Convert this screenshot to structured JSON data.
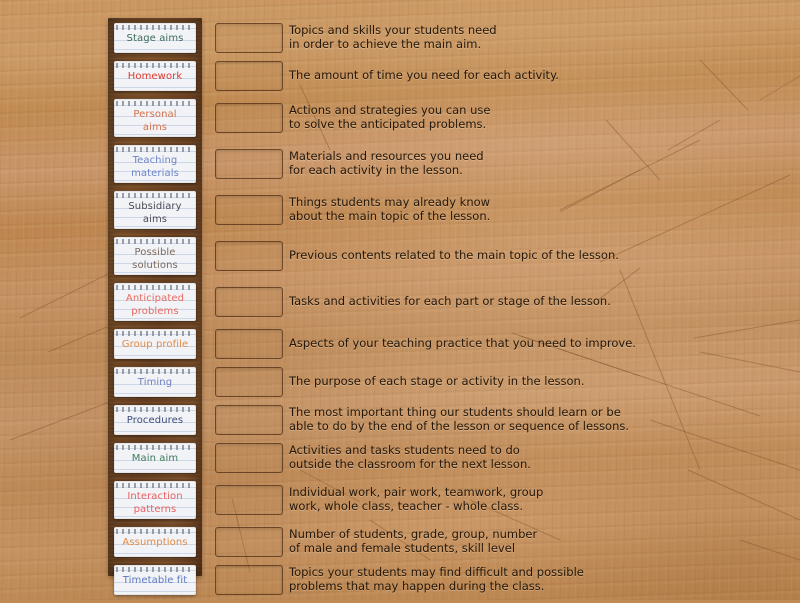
{
  "activity": {
    "type": "matching-drag-and-drop",
    "background": "wood-board"
  },
  "colors": {
    "board": "#6d4526",
    "tile_paper": "#f2f3f7",
    "wood": "#c08c54",
    "dropzone_border": "#4a2a10",
    "text": "#241608"
  },
  "tiles": [
    {
      "label": "Stage aims",
      "color": "#3e6b5a",
      "lines": 1
    },
    {
      "label": "Homework",
      "color": "#e0382c",
      "lines": 1
    },
    {
      "label": "Personal\naims",
      "color": "#d4704a",
      "lines": 2
    },
    {
      "label": "Teaching\nmaterials",
      "color": "#6d85c8",
      "lines": 2
    },
    {
      "label": "Subsidiary\naims",
      "color": "#4a4a55",
      "lines": 2
    },
    {
      "label": "Possible\nsolutions",
      "color": "#7b6a5c",
      "lines": 2
    },
    {
      "label": "Anticipated\nproblems",
      "color": "#e86a60",
      "lines": 2
    },
    {
      "label": "Group profile",
      "color": "#e08a44",
      "lines": 1
    },
    {
      "label": "Timing",
      "color": "#6f7fbf",
      "lines": 1
    },
    {
      "label": "Procedures",
      "color": "#3d4a7a",
      "lines": 1
    },
    {
      "label": "Main aim",
      "color": "#3f7a5c",
      "lines": 1
    },
    {
      "label": "Interaction\npatterns",
      "color": "#e8605e",
      "lines": 2
    },
    {
      "label": "Assumptions",
      "color": "#e08a44",
      "lines": 1
    },
    {
      "label": "Timetable fit",
      "color": "#5f78c0",
      "lines": 1
    }
  ],
  "dropzones": [
    {
      "value": "",
      "placeholder": ""
    },
    {
      "value": "",
      "placeholder": ""
    },
    {
      "value": "",
      "placeholder": ""
    },
    {
      "value": "",
      "placeholder": ""
    },
    {
      "value": "",
      "placeholder": ""
    },
    {
      "value": "",
      "placeholder": ""
    },
    {
      "value": "",
      "placeholder": ""
    },
    {
      "value": "",
      "placeholder": ""
    },
    {
      "value": "",
      "placeholder": ""
    },
    {
      "value": "",
      "placeholder": ""
    },
    {
      "value": "",
      "placeholder": ""
    },
    {
      "value": "",
      "placeholder": ""
    },
    {
      "value": "",
      "placeholder": ""
    },
    {
      "value": "",
      "placeholder": ""
    }
  ],
  "descriptions": [
    "Topics and skills your students need\nin order to achieve the main aim.",
    "The amount of time you need for each activity.",
    "Actions and strategies you can use\nto solve the anticipated problems.",
    "Materials and resources you need\nfor each activity in the lesson.",
    "Things students may already know\nabout the main topic of the lesson.",
    "Previous contents related to the main topic of the lesson.",
    "Tasks and activities for each part or stage of the lesson.",
    "Aspects of your teaching practice that you need to improve.",
    "The purpose of each stage or activity in the lesson.",
    "The most important thing our students should learn or be\nable to do by the end of the lesson or sequence of lessons.",
    "Activities and tasks students need to do\noutside the classroom for the next lesson.",
    "Individual work, pair work, teamwork, group\nwork, whole class, teacher - whole class.",
    "Number of students, grade, group, number\nof male and female students, skill level",
    "Topics your students may find difficult and possible\nproblems that may happen during the class."
  ]
}
